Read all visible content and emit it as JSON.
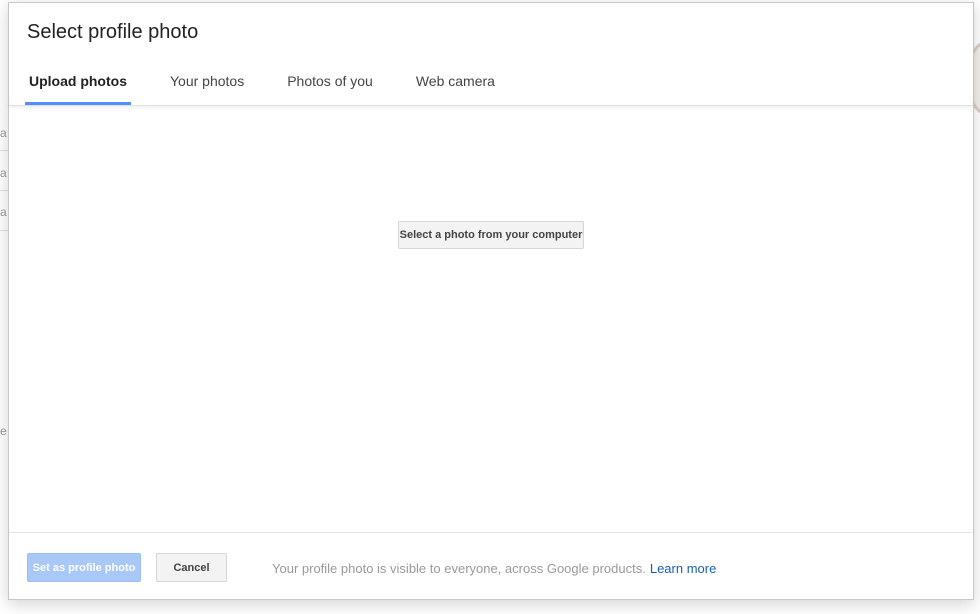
{
  "dialog": {
    "title": "Select profile photo",
    "tabs": [
      {
        "label": "Upload photos",
        "active": true
      },
      {
        "label": "Your photos",
        "active": false
      },
      {
        "label": "Photos of you",
        "active": false
      },
      {
        "label": "Web camera",
        "active": false
      }
    ],
    "upload": {
      "select_button_label": "Select a photo from your computer"
    },
    "footer": {
      "set_button_label": "Set as profile photo",
      "cancel_button_label": "Cancel",
      "note": "Your profile photo is visible to everyone, across Google products.",
      "learn_more_label": "Learn more"
    }
  },
  "background": {
    "fragments": [
      "a",
      "a",
      "a",
      "e"
    ]
  },
  "colors": {
    "accent": "#4d90fe",
    "primary_disabled": "#a8c8f8",
    "link": "#1a5fb4"
  }
}
